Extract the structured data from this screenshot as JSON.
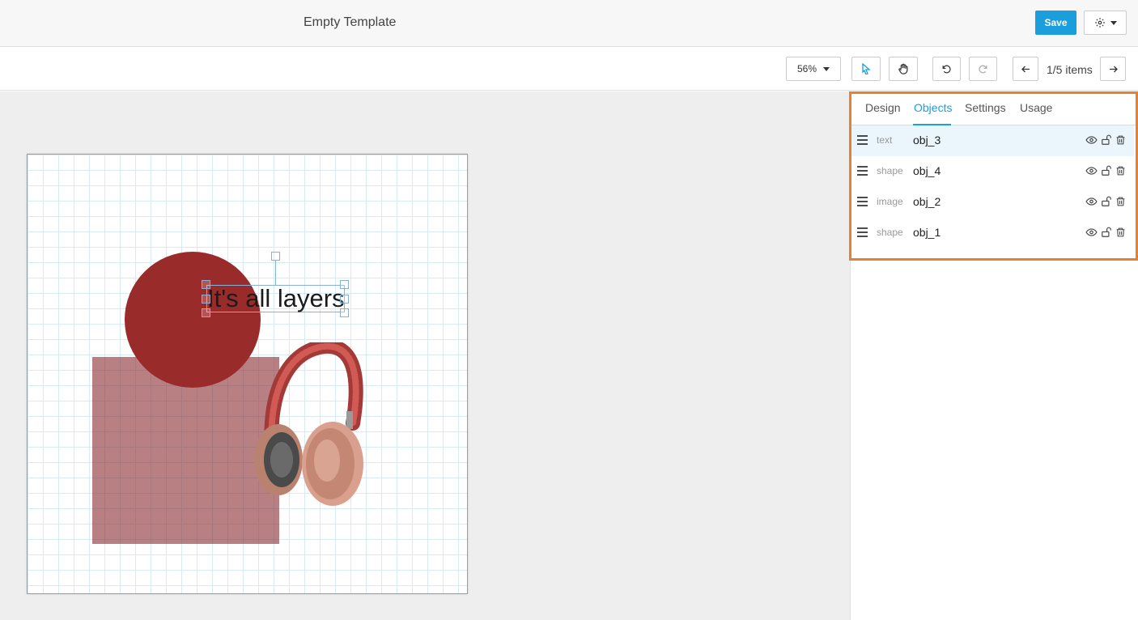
{
  "header": {
    "title": "Empty Template",
    "save_label": "Save",
    "settings_icon": "gear-icon"
  },
  "toolbar": {
    "zoom_value": "56%",
    "items_count": "1/5 items"
  },
  "canvas": {
    "text_content": "It's all layers",
    "colors": {
      "circle": "#9a2b2b",
      "square": "#a85a5f",
      "headphones": "#c0504d"
    }
  },
  "panel": {
    "tabs": [
      "Design",
      "Objects",
      "Settings",
      "Usage"
    ],
    "active_tab": "Objects",
    "objects": [
      {
        "type": "text",
        "name": "obj_3",
        "selected": true
      },
      {
        "type": "shape",
        "name": "obj_4",
        "selected": false
      },
      {
        "type": "image",
        "name": "obj_2",
        "selected": false
      },
      {
        "type": "shape",
        "name": "obj_1",
        "selected": false
      }
    ]
  },
  "colors": {
    "accent": "#1a9fdc",
    "highlight": "#e8812f"
  }
}
